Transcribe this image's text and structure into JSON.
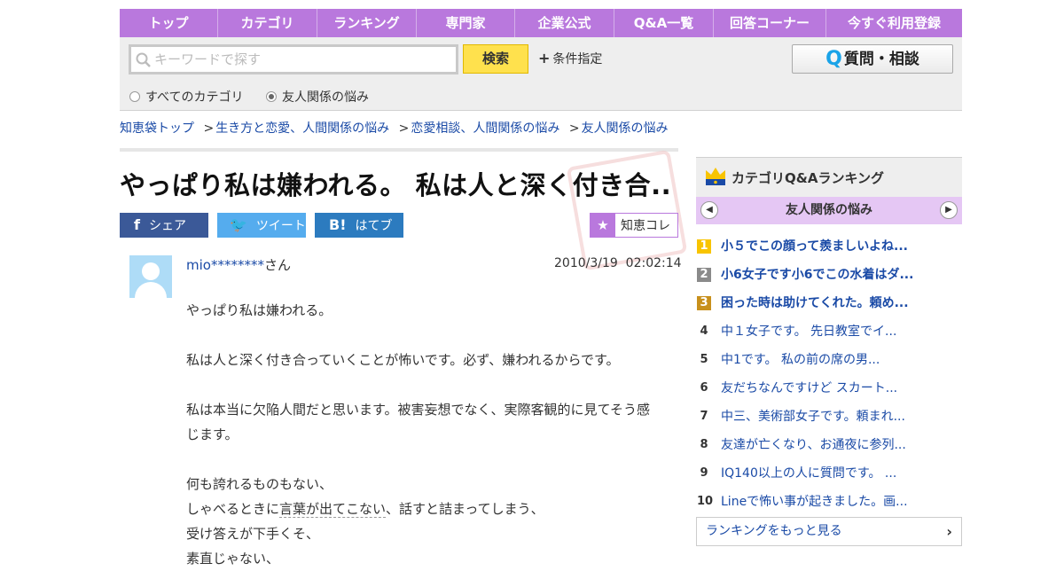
{
  "nav": [
    "トップ",
    "カテゴリ",
    "ランキング",
    "専門家",
    "企業公式",
    "Q&A一覧",
    "回答コーナー",
    "今すぐ利用登録"
  ],
  "search": {
    "placeholder": "キーワードで探す",
    "button": "検索",
    "conditions": "条件指定",
    "ask_button": "質問・相談",
    "ask_icon_letter": "Q",
    "radio_all": "すべてのカテゴリ",
    "radio_category": "友人関係の悩み"
  },
  "breadcrumb": [
    "知恵袋トップ",
    "生き方と恋愛、人間関係の悩み",
    "恋愛相談、人間関係の悩み",
    "友人関係の悩み"
  ],
  "question": {
    "title": "やっぱり私は嫌われる。 私は人と深く付き合...",
    "user": "mio********",
    "user_suffix": "さん",
    "date": "2010/3/19  02:02:14",
    "body_lines": [
      "やっぱり私は嫌われる。",
      "",
      "私は人と深く付き合っていくことが怖いです。必ず、嫌われるからです。",
      "",
      "私は本当に欠陥人間だと思います。被害妄想でなく、実際客観的に見てそう感じます。",
      "",
      "何も誇れるものもない、"
    ],
    "line_pre": "しゃべるときに",
    "line_underlined": "言葉が出てこない",
    "line_post": "、話すと詰まってしまう、",
    "line_after": "受け答えが下手くそ、",
    "line_cut": "素直じゃない、"
  },
  "share": {
    "facebook": "シェア",
    "twitter": "ツイート",
    "hatena_icon": "B!",
    "hatena": "はてブ",
    "chiekore": "知恵コレ"
  },
  "ranking": {
    "title": "カテゴリQ&Aランキング",
    "category": "友人関係の悩み",
    "items": [
      {
        "rank": "1",
        "text": "小５でこの顔って羨ましいよね..."
      },
      {
        "rank": "2",
        "text": "小6女子です小6でこの水着はダ..."
      },
      {
        "rank": "3",
        "text": "困った時は助けてくれた。頼め..."
      },
      {
        "rank": "4",
        "text": "中１女子です。 先日教室でイ..."
      },
      {
        "rank": "5",
        "text": "中1です。 私の前の席の男..."
      },
      {
        "rank": "6",
        "text": "友だちなんですけど スカート..."
      },
      {
        "rank": "7",
        "text": "中三、美術部女子です。頼まれ..."
      },
      {
        "rank": "8",
        "text": "友達が亡くなり、お通夜に参列..."
      },
      {
        "rank": "9",
        "text": "IQ140以上の人に質問です。 ..."
      },
      {
        "rank": "10",
        "text": "Lineで怖い事が起きました。画..."
      }
    ],
    "more": "ランキングをもっと見る"
  },
  "colors": {
    "nav_purple": "#b978dd",
    "search_yellow": "#ffe14d",
    "facebook": "#3b5998",
    "twitter": "#55acee",
    "hatena": "#2c7bbf"
  }
}
